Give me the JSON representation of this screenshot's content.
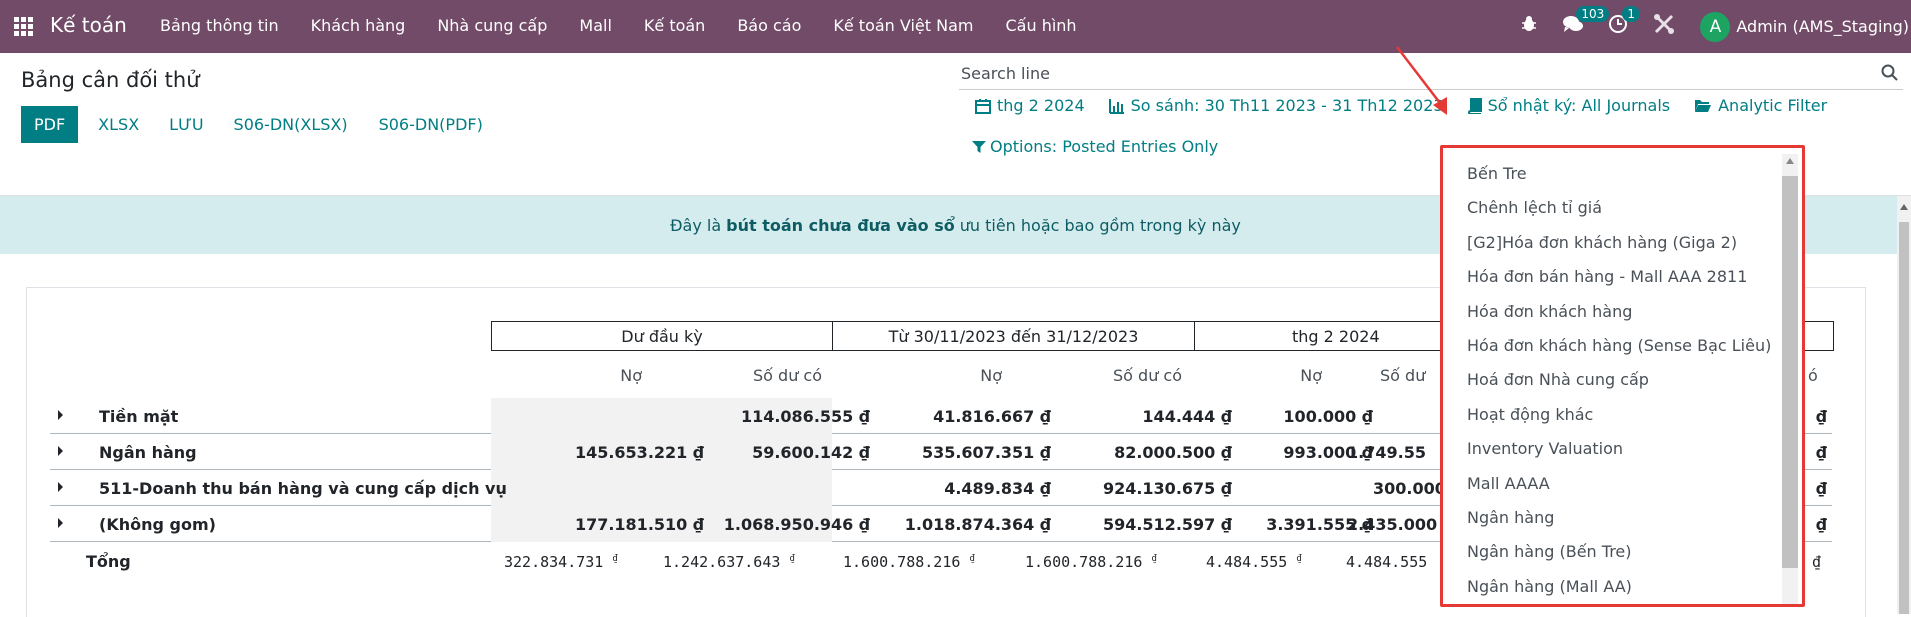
{
  "navbar": {
    "app_name": "Kế toán",
    "menu": [
      "Bảng thông tin",
      "Khách hàng",
      "Nhà cung cấp",
      "Mall",
      "Kế toán",
      "Báo cáo",
      "Kế toán Việt Nam",
      "Cấu hình"
    ],
    "messages_count": "103",
    "activities_count": "1",
    "avatar_letter": "A",
    "user": "Admin (AMS_Staging)"
  },
  "control": {
    "title": "Bảng cân đối thử",
    "buttons": [
      "PDF",
      "XLSX",
      "LƯU",
      "S06-DN(XLSX)",
      "S06-DN(PDF)"
    ],
    "search_placeholder": "Search line",
    "filters": {
      "date": "thg 2 2024",
      "compare": "So sánh: 30 Th11 2023 - 31 Th12 2023",
      "journals": "Sổ nhật ký: All Journals",
      "analytic": "Analytic Filter",
      "options": "Options: Posted Entries Only"
    }
  },
  "alert": {
    "prefix": "Đây là",
    "bold": "bút toán chưa đưa vào sổ",
    "suffix": "ưu tiên hoặc bao gồm trong kỳ này"
  },
  "table": {
    "groups": [
      "Dư đầu kỳ",
      "Từ 30/11/2023 đến 31/12/2023",
      "thg 2 2024"
    ],
    "subheaders": [
      "Nợ",
      "Số dư có",
      "Nợ",
      "Số dư có",
      "Nợ",
      "Số dư"
    ],
    "last_subheader_tail": "ó",
    "rows": [
      {
        "label": "Tiền mặt",
        "values": [
          "",
          "114.086.555 ₫",
          "41.816.667 ₫",
          "144.444 ₫",
          "100.000 ₫",
          ""
        ],
        "tail": "₫"
      },
      {
        "label": "Ngân hàng",
        "values": [
          "145.653.221 ₫",
          "59.600.142 ₫",
          "535.607.351 ₫",
          "82.000.500 ₫",
          "993.000 ₫",
          "1.749.55"
        ],
        "tail": "₫"
      },
      {
        "label": "511-Doanh thu bán hàng và cung cấp dịch vụ",
        "values": [
          "",
          "",
          "4.489.834 ₫",
          "924.130.675 ₫",
          "",
          "300.000"
        ],
        "tail": "₫"
      },
      {
        "label": "(Không gom)",
        "values": [
          "177.181.510 ₫",
          "1.068.950.946 ₫",
          "1.018.874.364 ₫",
          "594.512.597 ₫",
          "3.391.555 ₫",
          "2.435.000"
        ],
        "tail": "₫"
      }
    ],
    "total": {
      "label": "Tổng",
      "values": [
        "322.834.731",
        "1.242.637.643",
        "1.600.788.216",
        "1.600.788.216",
        "4.484.555",
        "4.484.555"
      ],
      "currency": "₫"
    }
  },
  "journal_dropdown": {
    "items": [
      "Bến Tre",
      "Chênh lệch tỉ giá",
      "[G2]Hóa đơn khách hàng (Giga 2)",
      "Hóa đơn bán hàng - Mall AAA 2811",
      "Hóa đơn khách hàng",
      "Hóa đơn khách hàng (Sense Bạc Liêu)",
      "Hoá đơn Nhà cung cấp",
      "Hoạt động khác",
      "Inventory Valuation",
      "Mall AAAA",
      "Ngân hàng",
      "Ngân hàng (Bến Tre)",
      "Ngân hàng (Mall AA)"
    ]
  },
  "colors": {
    "navbar": "#714b67",
    "accent": "#017e84",
    "highlight": "#e53935",
    "alert_bg": "#d4ecee"
  }
}
